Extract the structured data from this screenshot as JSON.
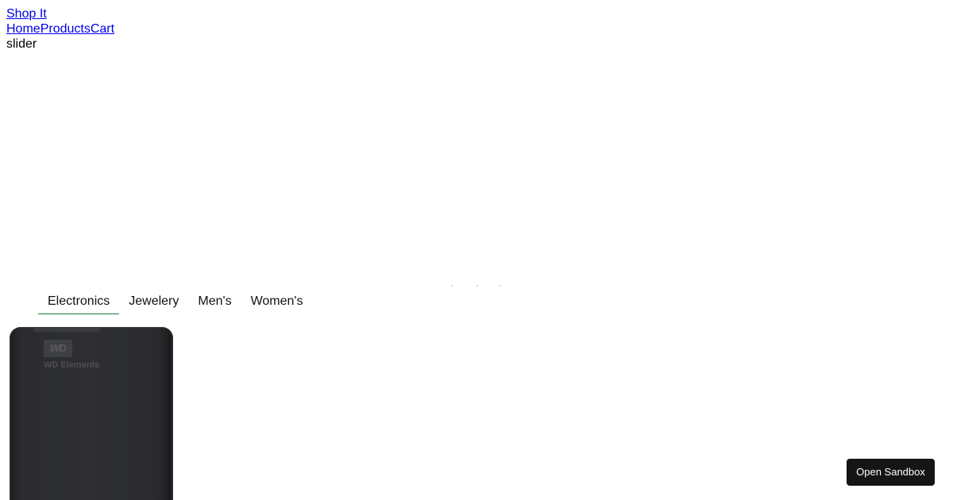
{
  "header": {
    "brand": "Shop It",
    "nav": [
      "Home",
      "Products",
      "Cart"
    ]
  },
  "slider": {
    "alt_text": "slider",
    "dots": 3
  },
  "categories": {
    "tabs": [
      "Electronics",
      "Jewelery",
      "Men's",
      "Women's"
    ],
    "active_index": 0,
    "accent_color": "#1a7f37"
  },
  "product": {
    "logo_text": "WD",
    "label": "WD Elements"
  },
  "sandbox_button": {
    "label": "Open Sandbox",
    "background": "#151515"
  }
}
